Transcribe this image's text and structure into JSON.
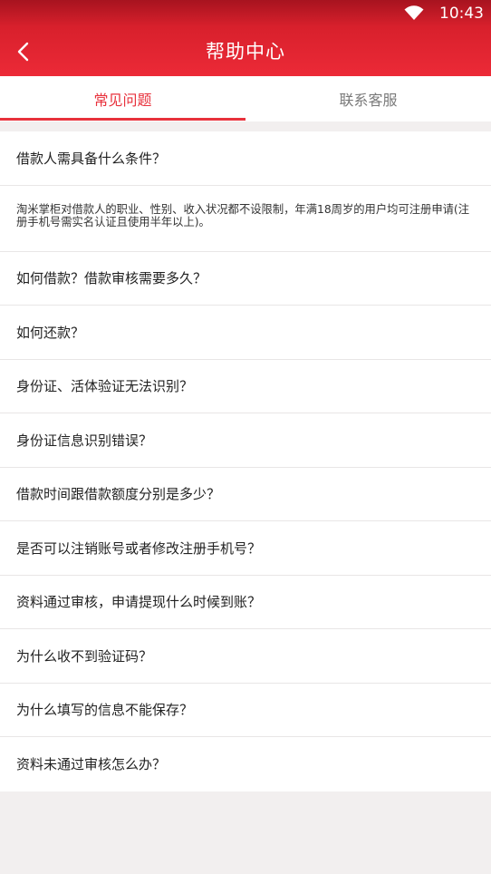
{
  "status_bar": {
    "time": "10:43",
    "wifi_icon": "wifi-icon"
  },
  "title_bar": {
    "back_icon": "chevron-left-icon",
    "title": "帮助中心"
  },
  "tabs": [
    {
      "label": "常见问题",
      "active": true
    },
    {
      "label": "联系客服",
      "active": false
    }
  ],
  "faq": {
    "first_question": "借款人需具备什么条件？",
    "first_answer": "淘米掌柜对借款人的职业、性别、收入状况都不设限制，年满18周岁的用户均可注册申请(注册手机号需实名认证且使用半年以上)。",
    "questions": [
      "如何借款？借款审核需要多久？",
      "如何还款？",
      "身份证、活体验证无法识别？",
      "身份证信息识别错误？",
      "借款时间跟借款额度分别是多少？",
      "是否可以注销账号或者修改注册手机号？",
      "资料通过审核，申请提现什么时候到账？",
      "为什么收不到验证码？",
      "为什么填写的信息不能保存？",
      "资料未通过审核怎么办？"
    ]
  },
  "colors": {
    "header_red": "#e8303c",
    "accent": "#e8313c",
    "background": "#f2efef"
  }
}
